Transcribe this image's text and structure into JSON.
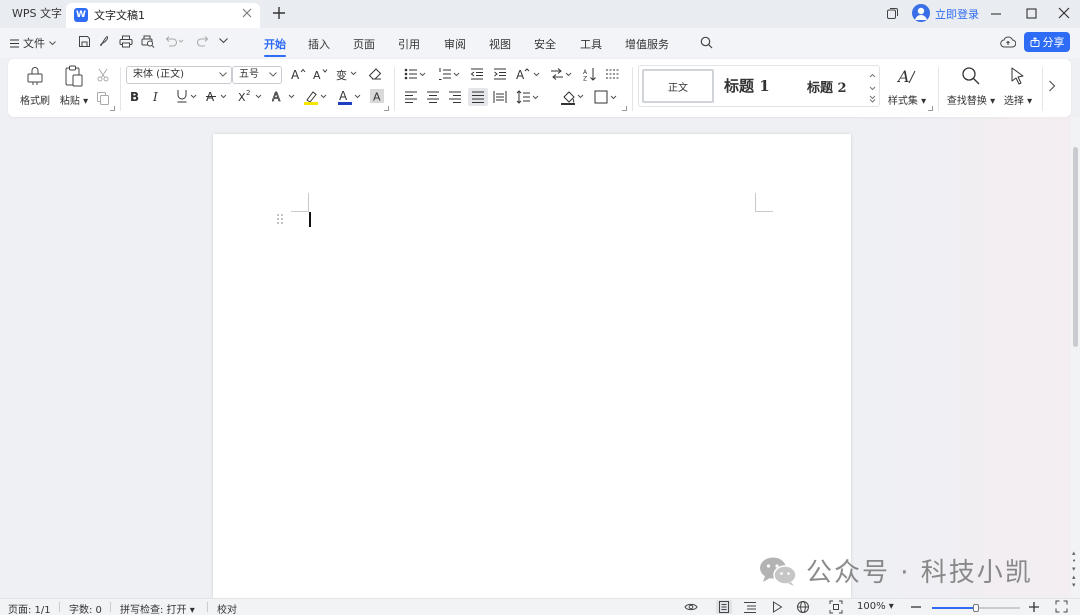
{
  "titlebar": {
    "app_name": "WPS 文字",
    "doc_tab": "文字文稿1",
    "doc_icon_letter": "W",
    "login": "立即登录"
  },
  "menu": {
    "file": "文件",
    "tabs": [
      "开始",
      "插入",
      "页面",
      "引用",
      "审阅",
      "视图",
      "安全",
      "工具",
      "增值服务"
    ],
    "active_tab": "开始",
    "share": "分享"
  },
  "ribbon": {
    "format_painter": "格式刷",
    "paste": "粘贴",
    "font_name": "宋体 (正文)",
    "font_size": "五号",
    "styles": [
      "正文",
      "标题 1",
      "标题 2"
    ],
    "style_set": "样式集",
    "find_replace": "查找替换",
    "select": "选择"
  },
  "status": {
    "page": "页面: 1/1",
    "words": "字数: 0",
    "spell": "拼写检查: 打开",
    "proof": "校对",
    "zoom": "100%",
    "zoom_level": 0.5
  },
  "watermark": {
    "text": "公众号 · 科技小凯"
  },
  "colors": {
    "accent": "#2f6cf5",
    "font_color_bar": "#1a3fbf",
    "highlight_bar": "#f5e400"
  }
}
